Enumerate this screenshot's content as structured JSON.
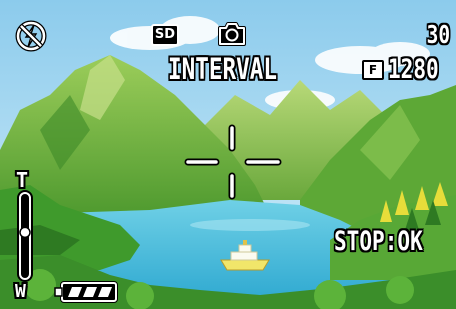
{
  "osd": {
    "flash_mode": "flash-off-icon",
    "media": "SD",
    "shooting_mode": "camera-icon",
    "shots_remaining": "30",
    "mode_label": "INTERVAL",
    "quality_badge": "F",
    "image_size": "1280",
    "instruction": "STOP:OK",
    "zoom": {
      "tele_label": "T",
      "wide_label": "W",
      "level": 0.55
    },
    "battery": {
      "level": "full",
      "bars": 3
    }
  },
  "colors": {
    "osd_text": "#ffffff",
    "outline": "#000000",
    "sky": "#9ed2ee",
    "lake": "#36b7d6",
    "mountain": "#7fbc45",
    "forest": "#3f9a2c"
  }
}
